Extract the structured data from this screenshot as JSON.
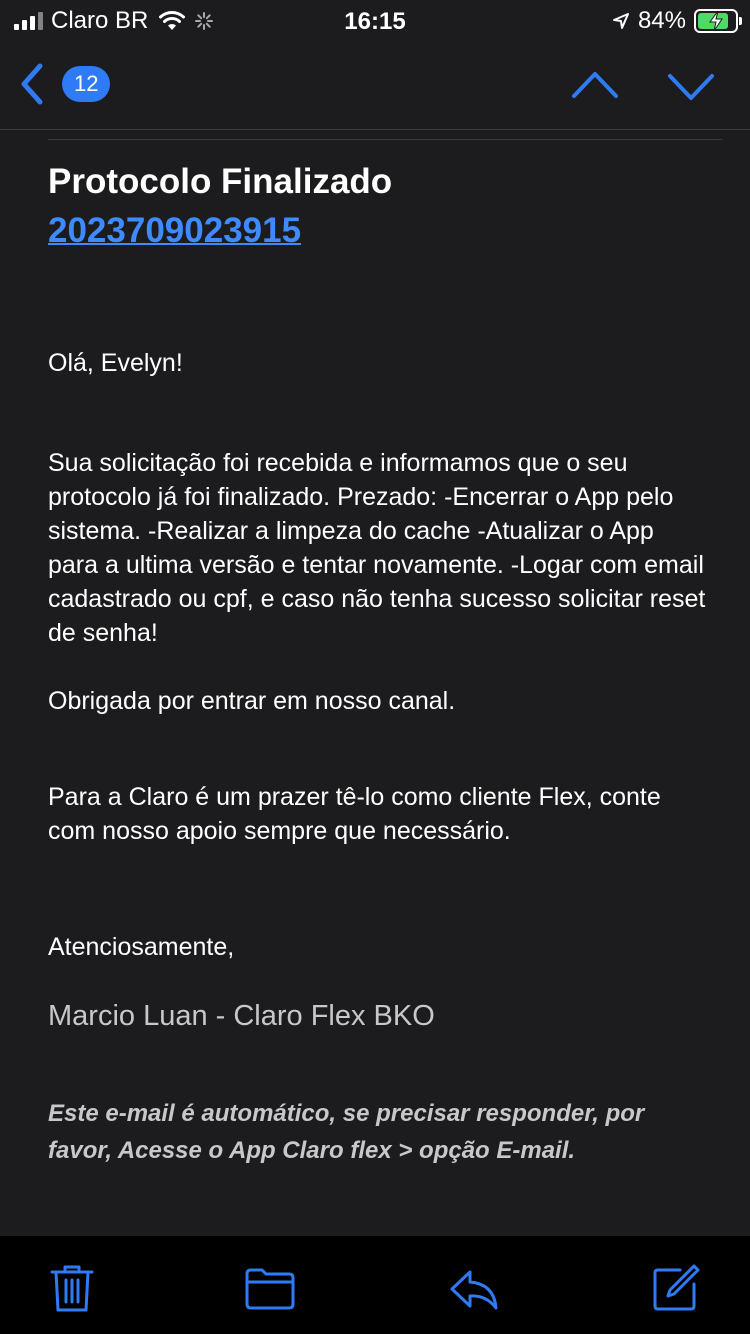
{
  "status_bar": {
    "carrier": "Claro BR",
    "time": "16:15",
    "battery": "84%",
    "battery_level": 0.84
  },
  "nav": {
    "unread_count": "12"
  },
  "email": {
    "subject": "Protocolo Finalizado",
    "protocol_number": "2023709023915",
    "greeting": "Olá, Evelyn!",
    "body": "Sua solicitação foi recebida e informamos que o seu protocolo já foi finalizado. Prezado: -Encerrar o App pelo sistema. -Realizar a limpeza do cache -Atualizar o App para a ultima versão e tentar novamente. -Logar com email cadastrado ou cpf, e caso não tenha sucesso solicitar reset de senha!",
    "thanks": "Obrigada por entrar em nosso canal.",
    "closing": "Para a Claro é um prazer tê-lo como cliente Flex, conte com nosso apoio sempre que necessário.",
    "regards": "Atenciosamente,",
    "signature": "Marcio Luan - Claro Flex BKO",
    "footer_note": " Este e-mail é automático, se precisar responder, por favor, Acesse o App Claro flex > opção E-mail."
  },
  "colors": {
    "accent": "#2f7bf5",
    "link": "#3d8bff",
    "background": "#1c1c1e",
    "toolbar": "#000000",
    "battery_fill": "#4cd964"
  },
  "icons": {
    "back": "chevron-left-icon",
    "previous": "chevron-up-icon",
    "next": "chevron-down-icon",
    "trash": "trash-icon",
    "folder": "folder-icon",
    "reply": "reply-icon",
    "compose": "compose-icon"
  }
}
